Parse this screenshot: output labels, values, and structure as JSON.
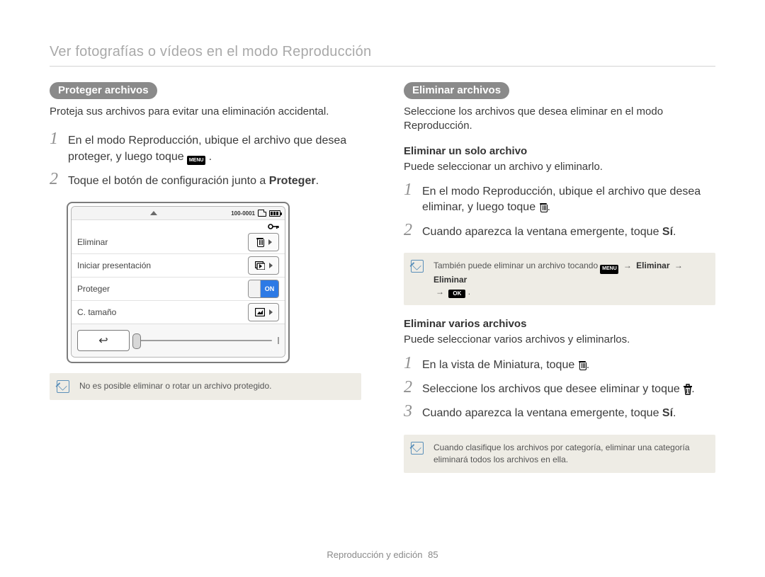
{
  "header": {
    "title": "Ver fotografías o vídeos en el modo Reproducción"
  },
  "left": {
    "section_pill": "Proteger archivos",
    "intro": "Proteja sus archivos para evitar una eliminación accidental.",
    "steps": [
      {
        "num": "1",
        "pre": "En el modo Reproducción, ubique el archivo que desea proteger, y luego toque ",
        "menu_label": "MENU",
        "post": "."
      },
      {
        "num": "2",
        "pre": "Toque el botón de configuración junto a ",
        "bold": "Proteger",
        "post": "."
      }
    ],
    "device": {
      "file_counter": "100-0001",
      "rows": {
        "eliminar": "Eliminar",
        "iniciar": "Iniciar presentación",
        "proteger": "Proteger",
        "proteger_on": "ON",
        "ctamano": "C. tamaño"
      }
    },
    "note": "No es posible eliminar o rotar un archivo protegido."
  },
  "right": {
    "section_pill": "Eliminar archivos",
    "intro": "Seleccione los archivos que desea eliminar en el modo Reproducción.",
    "single": {
      "head": "Eliminar un solo archivo",
      "sub": "Puede seleccionar un archivo y eliminarlo.",
      "steps": [
        {
          "num": "1",
          "pre": "En el modo Reproducción, ubique el archivo que desea eliminar, y luego toque ",
          "trash_after": true,
          "post": "."
        },
        {
          "num": "2",
          "pre": "Cuando aparezca la ventana emergente, toque ",
          "bold": "Sí",
          "post": "."
        }
      ],
      "note_parts": {
        "pre": "También puede eliminar un archivo tocando ",
        "menu_label": "MENU",
        "arrow": "→",
        "b1": "Eliminar",
        "b2": "Eliminar",
        "line2_arrow": "→",
        "ok_label": "OK",
        "end": "."
      }
    },
    "multi": {
      "head": "Eliminar varios archivos",
      "sub": "Puede seleccionar varios archivos y eliminarlos.",
      "steps": [
        {
          "num": "1",
          "pre": "En la vista de Miniatura, toque ",
          "trash_after": true,
          "post": "."
        },
        {
          "num": "2",
          "pre": "Seleccione los archivos que desee eliminar y toque ",
          "trash_bag_after": true,
          "post": "."
        },
        {
          "num": "3",
          "pre": "Cuando aparezca la ventana emergente, toque ",
          "bold": "Sí",
          "post": "."
        }
      ],
      "note": "Cuando clasifique los archivos por categoría, eliminar una categoría eliminará todos los archivos en ella."
    }
  },
  "footer": {
    "section": "Reproducción y edición",
    "page": "85"
  }
}
